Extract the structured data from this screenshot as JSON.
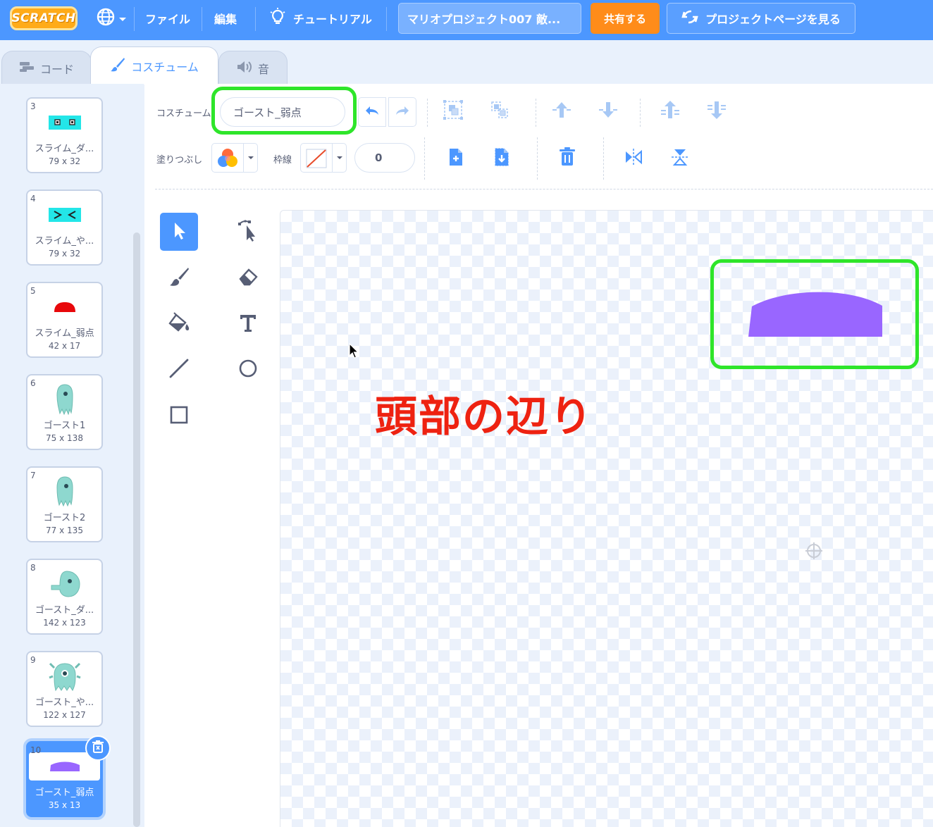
{
  "menubar": {
    "logo": "SCRATCH",
    "file": "ファイル",
    "edit": "編集",
    "tutorials": "チュートリアル",
    "project_title": "マリオプロジェクト007 敵...",
    "share": "共有する",
    "see_project_page": "プロジェクトページを見る"
  },
  "tabs": {
    "code": "コード",
    "costumes": "コスチューム",
    "sounds": "音"
  },
  "costumes": [
    {
      "num": "3",
      "name": "スライム_ダ...",
      "size": "79 x 32"
    },
    {
      "num": "4",
      "name": "スライム_や...",
      "size": "79 x 32"
    },
    {
      "num": "5",
      "name": "スライム_弱点",
      "size": "42 x 17"
    },
    {
      "num": "6",
      "name": "ゴースト1",
      "size": "75 x 138"
    },
    {
      "num": "7",
      "name": "ゴースト2",
      "size": "77 x 135"
    },
    {
      "num": "8",
      "name": "ゴースト_ダ...",
      "size": "142 x 123"
    },
    {
      "num": "9",
      "name": "ゴースト_や...",
      "size": "122 x 127"
    },
    {
      "num": "10",
      "name": "ゴースト_弱点",
      "size": "35 x 13"
    }
  ],
  "editor": {
    "costume_label": "コスチューム",
    "costume_name": "ゴースト_弱点",
    "fill_label": "塗りつぶし",
    "outline_label": "枠線",
    "outline_width": "0"
  },
  "annotation": {
    "text": "頭部の辺り"
  },
  "colors": {
    "menubar": "#4c97ff",
    "share": "#ff8c1a",
    "shape_fill": "#9966ff",
    "highlight": "#2ee52a",
    "annotation": "#ee2211"
  }
}
